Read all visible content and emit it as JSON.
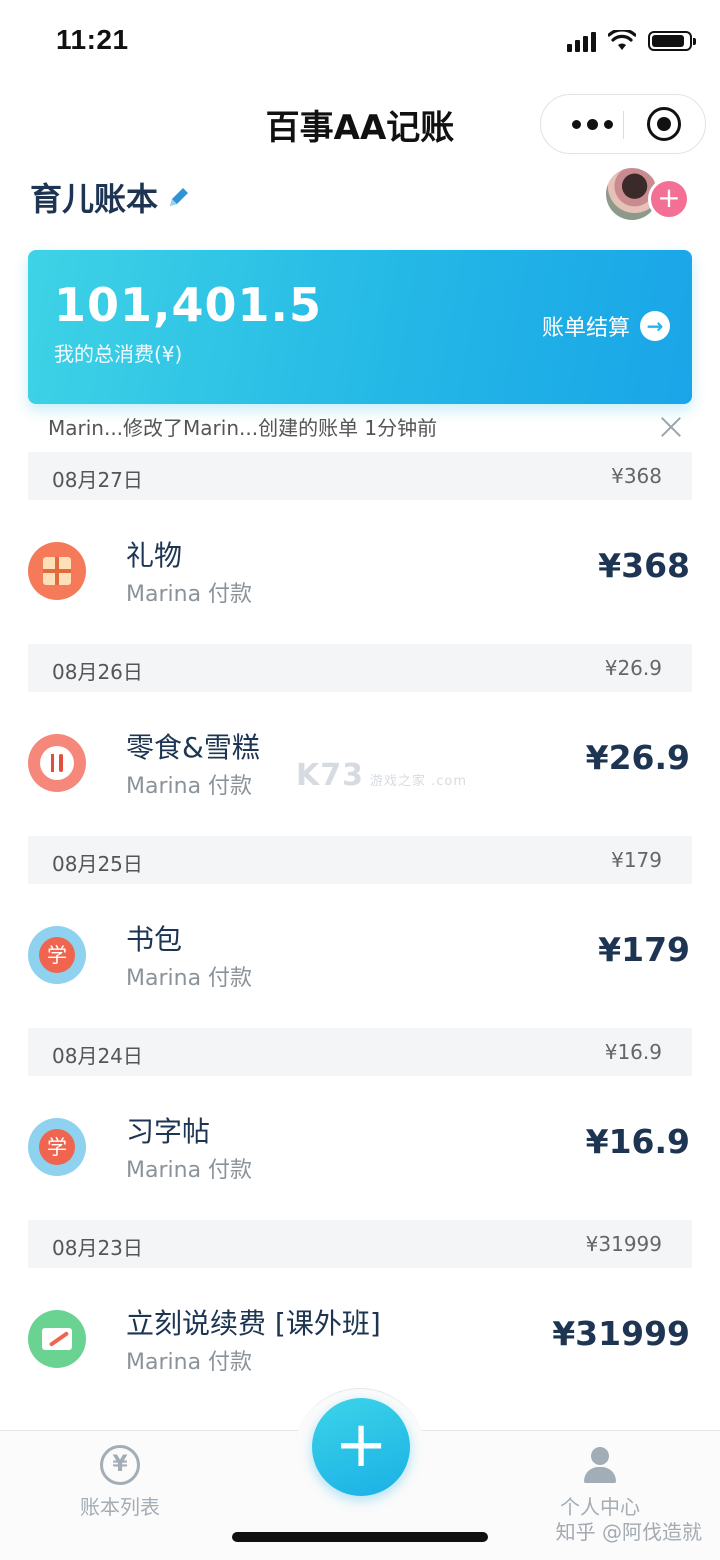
{
  "status_bar": {
    "time": "11:21"
  },
  "nav": {
    "title": "百事AA记账"
  },
  "book": {
    "title": "育儿账本",
    "add_member": "+"
  },
  "summary": {
    "amount": "101,401.5",
    "label": "我的总消费(¥)",
    "settle_label": "账单结算",
    "settle_icon": "→"
  },
  "notice": {
    "text": "Marin...修改了Marin...创建的账单   1分钟前"
  },
  "groups": [
    {
      "date": "08月27日",
      "total": "¥368",
      "entry": {
        "name": "礼物",
        "payer": "Marina 付款",
        "amount": "¥368",
        "icon": "gift-icon"
      }
    },
    {
      "date": "08月26日",
      "total": "¥26.9",
      "entry": {
        "name": "零食&雪糕",
        "payer": "Marina 付款",
        "amount": "¥26.9",
        "icon": "food-icon"
      }
    },
    {
      "date": "08月25日",
      "total": "¥179",
      "entry": {
        "name": "书包",
        "payer": "Marina 付款",
        "amount": "¥179",
        "icon": "study-icon",
        "icon_text": "学"
      }
    },
    {
      "date": "08月24日",
      "total": "¥16.9",
      "entry": {
        "name": "习字帖",
        "payer": "Marina 付款",
        "amount": "¥16.9",
        "icon": "study-icon",
        "icon_text": "学"
      }
    },
    {
      "date": "08月23日",
      "total": "¥31999",
      "entry": {
        "name": "立刻说续费 [课外班]",
        "payer": "Marina 付款",
        "amount": "¥31999",
        "icon": "note-icon"
      }
    }
  ],
  "watermark": {
    "main": "K73",
    "sub": "游戏之家 .com"
  },
  "tabbar": {
    "ledger_label": "账本列表",
    "ledger_icon_text": "¥",
    "add_label": "+",
    "profile_label": "个人中心"
  },
  "brand": "知乎 @阿伐造就",
  "colors": {
    "accent": "#24b8e6",
    "title": "#1d3552",
    "add_member": "#f36f94"
  }
}
